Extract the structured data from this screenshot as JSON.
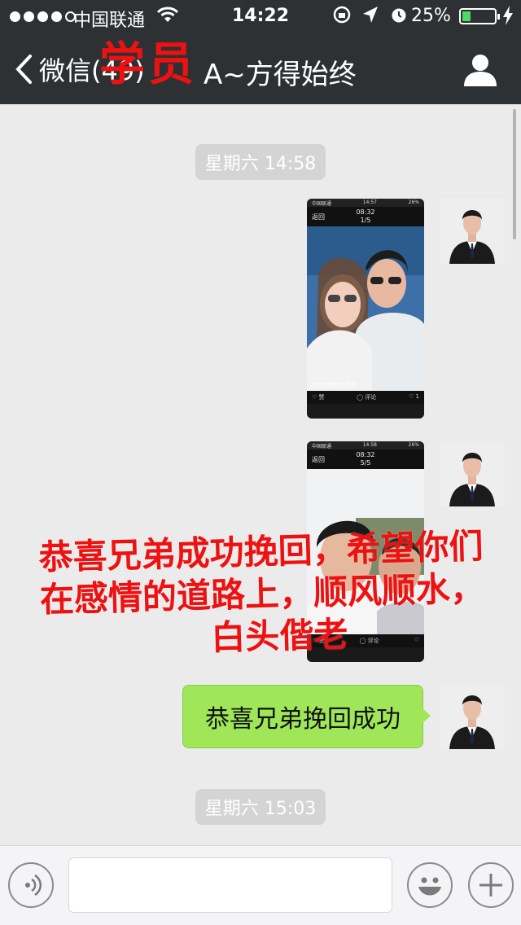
{
  "status_bar": {
    "carrier": "中国联通",
    "time": "14:22",
    "battery_percent_text": "25%",
    "battery_level": 0.25
  },
  "nav": {
    "back_label": "微信(49)",
    "title": "A~方得始终"
  },
  "overlay": {
    "students_text": "学员",
    "congrats_line1": "恭喜兄弟成功挽回，希望你们",
    "congrats_line2": "在感情的道路上，顺风顺水，",
    "congrats_line3": "白头偕老"
  },
  "messages": {
    "timestamp1": "星期六 14:58",
    "image1": {
      "time": "08:32",
      "counter": "1/5",
      "back": "返回",
      "caption": "六堂鸡蛋饼😊😊😊"
    },
    "image2": {
      "time": "08:32",
      "counter": "5/5",
      "back": "返回"
    },
    "text_message": "恭喜兄弟挽回成功",
    "timestamp2": "星期六 15:03"
  },
  "colors": {
    "nav_bg": "#2e3134",
    "chat_bg": "#ebebeb",
    "bubble": "#9fe658",
    "overlay_red": "#e11"
  }
}
